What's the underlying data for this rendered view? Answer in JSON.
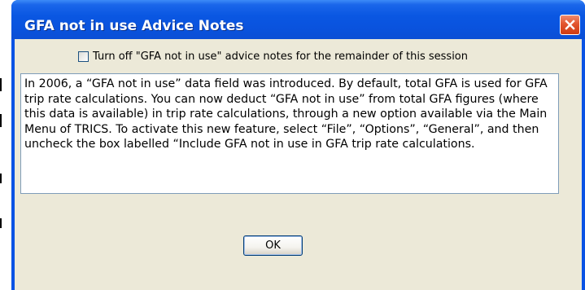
{
  "window": {
    "title": "GFA not in use Advice Notes",
    "close_icon": "close-icon"
  },
  "checkbox": {
    "label": "Turn off \"GFA not in use\" advice notes for the remainder of this session",
    "checked": false
  },
  "advice": {
    "text": "In 2006, a “GFA not in use” data field was introduced. By default, total GFA is used for GFA trip rate calculations. You can now deduct “GFA not in use” from total GFA figures (where this data is available) in trip rate calculations, through a new option available via the Main Menu of TRICS. To activate this new feature, select “File”, “Options”, “General”, and then uncheck the box labelled “Include GFA not in use in GFA trip rate calculations."
  },
  "buttons": {
    "ok_label": "OK"
  },
  "colors": {
    "title_bar": "#0a53e4",
    "close_button": "#e2552e",
    "dialog_face": "#ece9d8"
  }
}
